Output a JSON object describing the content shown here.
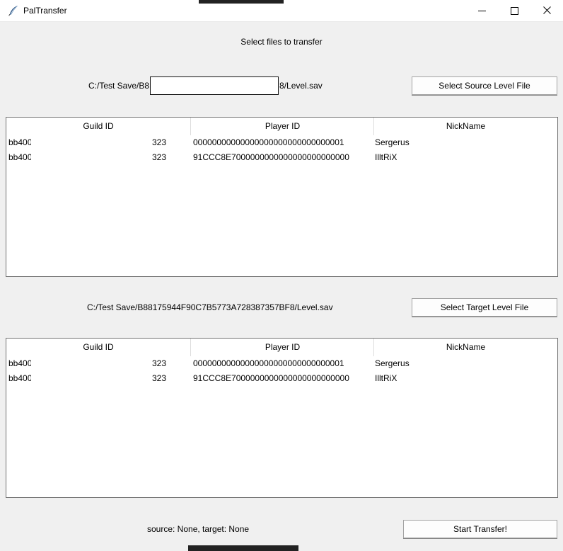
{
  "window": {
    "title": "PalTransfer",
    "controls": {
      "minimize_glyph": "–",
      "maximize_glyph": "□",
      "close_glyph": "✕"
    }
  },
  "icons": {
    "app_icon": "python-feather-icon",
    "minimize": "minimize-icon",
    "maximize": "maximize-icon",
    "close": "close-icon"
  },
  "instruction": "Select files to transfer",
  "source_section": {
    "path_prefix": "C:/Test Save/B8",
    "path_suffix": "8/Level.sav",
    "redaction": "white-box-over-path",
    "select_button": "Select Source Level File"
  },
  "target_section": {
    "path": "C:/Test Save/B88175944F90C7B5773A728387357BF8/Level.sav",
    "select_button": "Select Target Level File"
  },
  "columns": {
    "guild": "Guild ID",
    "player": "Player ID",
    "nick": "NickName"
  },
  "source_table": {
    "rows": [
      {
        "guild_label": "bb400",
        "guild_id": "323",
        "player_id": "00000000000000000000000000000001",
        "nickname": "Sergerus"
      },
      {
        "guild_label": "bb400",
        "guild_id": "323",
        "player_id": "91CCC8E7000000000000000000000000",
        "nickname": "IlltRiX"
      }
    ]
  },
  "target_table": {
    "rows": [
      {
        "guild_label": "bb400",
        "guild_id": "323",
        "player_id": "00000000000000000000000000000001",
        "nickname": "Sergerus"
      },
      {
        "guild_label": "bb400",
        "guild_id": "323",
        "player_id": "91CCC8E7000000000000000000000000",
        "nickname": "IlltRiX"
      }
    ]
  },
  "footer": {
    "status": "source: None, target: None",
    "transfer_button": "Start Transfer!"
  },
  "colors": {
    "window_bg": "#f0f0f0",
    "titlebar_bg": "#ffffff",
    "table_bg": "#ffffff",
    "table_border": "#737373",
    "header_separator": "#dcdcdc",
    "button_bg": "#fdfdfd",
    "button_border": "#a3a3a3",
    "redaction_border": "#141414",
    "dark_bar": "#222222"
  }
}
